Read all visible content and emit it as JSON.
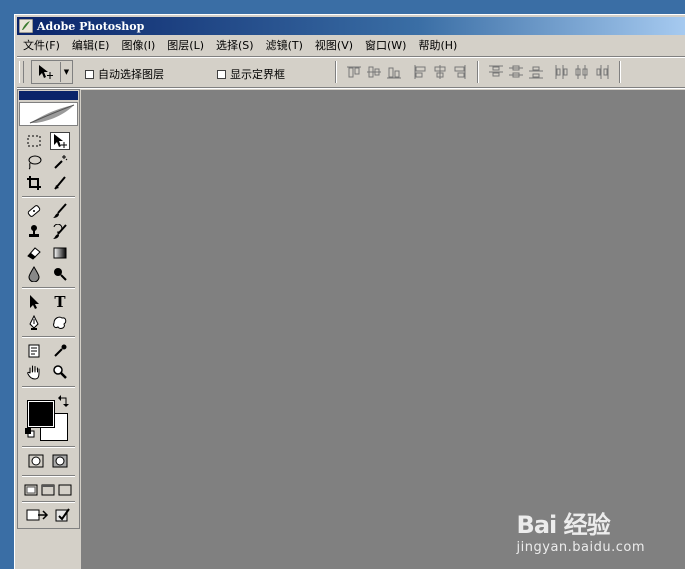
{
  "window": {
    "title": "Adobe Photoshop"
  },
  "menubar": {
    "items": [
      "文件(F)",
      "编辑(E)",
      "图像(I)",
      "图层(L)",
      "选择(S)",
      "滤镜(T)",
      "视图(V)",
      "窗口(W)",
      "帮助(H)"
    ]
  },
  "options_bar": {
    "auto_select_label": "自动选择图层",
    "show_bounds_label": "显示定界框",
    "auto_select_checked": false,
    "show_bounds_checked": false
  },
  "toolbox": {
    "tools": [
      "rectangular-marquee",
      "move",
      "lasso",
      "magic-wand",
      "crop",
      "slice",
      "healing-brush",
      "brush",
      "clone-stamp",
      "history-brush",
      "eraser",
      "gradient",
      "blur",
      "dodge",
      "path-selection",
      "type",
      "pen",
      "custom-shape",
      "notes",
      "eyedropper",
      "hand",
      "zoom"
    ],
    "foreground_color": "#000000",
    "background_color": "#ffffff",
    "type_tool_glyph": "T"
  },
  "workspace": {
    "color": "#808080"
  },
  "watermark": {
    "brand": "Bai 经验",
    "url": "jingyan.baidu.com"
  },
  "colors": {
    "desktop": "#3a6ea5",
    "title_bar": "#0a246a",
    "chrome": "#d4d0c8"
  }
}
